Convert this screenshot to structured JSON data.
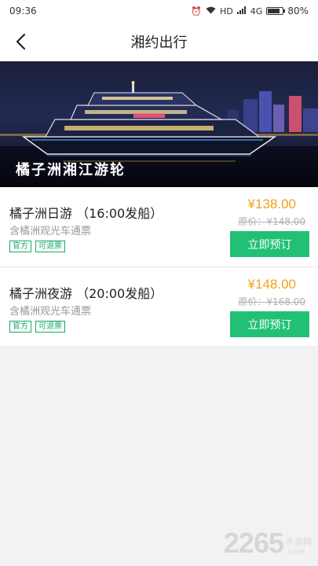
{
  "status_bar": {
    "time": "09:36",
    "network": "HD",
    "signal_type": "4G",
    "battery_percent": "80%",
    "battery_level": 0.8
  },
  "nav": {
    "title": "湘约出行",
    "back_icon": "chevron-left-icon"
  },
  "banner": {
    "title": "橘子洲湘江游轮"
  },
  "items": [
    {
      "name": "橘子洲日游 （16:00发船）",
      "desc": "含橘洲观光车通票",
      "tags": [
        "官方",
        "可退票"
      ],
      "price": "¥138.00",
      "original_price": "原价：¥148.00",
      "button": "立即预订"
    },
    {
      "name": "橘子洲夜游 （20:00发船）",
      "desc": "含橘洲观光车通票",
      "tags": [
        "官方",
        "可退票"
      ],
      "price": "¥148.00",
      "original_price": "原价：¥168.00",
      "button": "立即预订"
    }
  ],
  "watermark": {
    "number": "2265",
    "cn": "手游网",
    "domain": ".com"
  },
  "colors": {
    "accent_green": "#22c074",
    "price_orange": "#f1a21a",
    "tag_green": "#16a96a"
  }
}
